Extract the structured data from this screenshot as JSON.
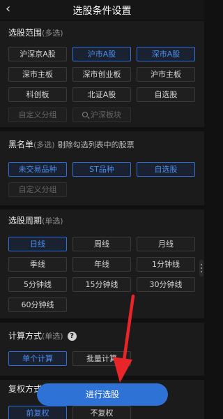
{
  "header": {
    "back_icon": "chevron-left-icon",
    "back_glyph": "‹",
    "title": "选股条件设置"
  },
  "range": {
    "title": "选股范围",
    "subtitle": "(多选)",
    "options": [
      "沪深京A股",
      "沪市A股",
      "深市A股",
      "深市主板",
      "深市创业板",
      "沪市主板",
      "科创板",
      "北证A股",
      "自选股",
      "自定义分组",
      "沪深板块"
    ]
  },
  "blacklist": {
    "title": "黑名单",
    "subtitle": "(多选)",
    "desc": "剔除勾选列表中的股票",
    "options": [
      "未交易品种",
      "ST品种",
      "自选股",
      "自定义分组"
    ]
  },
  "period": {
    "title": "选股周期",
    "subtitle": "(单选)",
    "options": [
      "日线",
      "周线",
      "月线",
      "季线",
      "年线",
      "1分钟线",
      "5分钟线",
      "15分钟线",
      "30分钟线",
      "60分钟线"
    ]
  },
  "calc": {
    "title": "计算方式",
    "subtitle": "(单选)",
    "help_glyph": "?",
    "options": [
      "单个计算",
      "批量计算"
    ]
  },
  "adjust": {
    "title": "复权方式",
    "options": [
      "前复权",
      "不复权"
    ]
  },
  "cta": {
    "label": "进行选股"
  },
  "colors": {
    "accent": "#2f72d6",
    "selected_text": "#4d8df0",
    "annotation_arrow": "#e8262a"
  }
}
